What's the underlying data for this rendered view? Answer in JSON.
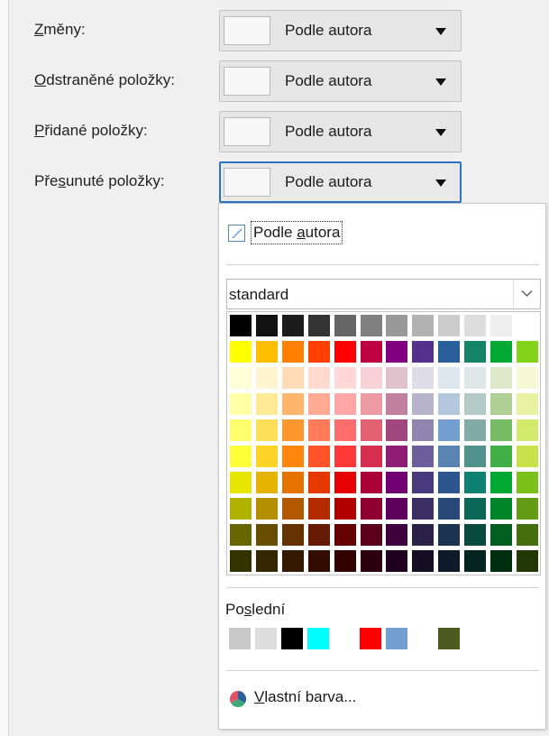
{
  "rows": [
    {
      "label": "Změny",
      "mnemonic_index": 0,
      "value": "Podle autora",
      "focused": false
    },
    {
      "label": "Odstraněné položky",
      "mnemonic_index": 0,
      "value": "Podle autora",
      "focused": false
    },
    {
      "label": "Přidané položky",
      "mnemonic_index": 0,
      "value": "Podle autora",
      "focused": false
    },
    {
      "label": "Přesunuté položky",
      "mnemonic_index": 3,
      "value": "Podle autora",
      "focused": true
    }
  ],
  "label_suffix": ":",
  "popup": {
    "auto_label": "Podle autora",
    "auto_mnemonic_index": 6,
    "palette_value": "standard",
    "palette_grid": [
      [
        "#000000",
        "#111111",
        "#1c1c1c",
        "#333333",
        "#666666",
        "#808080",
        "#999999",
        "#b2b2b2",
        "#cccccc",
        "#dddddd",
        "#eeeeee",
        "#ffffff"
      ],
      [
        "#ffff00",
        "#ffbf00",
        "#ff8000",
        "#ff4000",
        "#ff0000",
        "#bf0041",
        "#800080",
        "#55308d",
        "#2a6099",
        "#158466",
        "#00a933",
        "#81d41a"
      ],
      [
        "#ffffd7",
        "#fff5ce",
        "#ffdbb6",
        "#ffd8ce",
        "#ffd7d7",
        "#f7d1d5",
        "#e0c2cd",
        "#dedce6",
        "#dee6ef",
        "#dee7e5",
        "#dde8cb",
        "#f6f9d4"
      ],
      [
        "#ffffa6",
        "#ffe994",
        "#ffb66c",
        "#ffaa95",
        "#ffa6a6",
        "#ec9ba4",
        "#bf819e",
        "#b7b3ca",
        "#b4c7dc",
        "#b3cac7",
        "#afd095",
        "#e8f2a1"
      ],
      [
        "#ffff6d",
        "#ffde59",
        "#ff972f",
        "#ff7b59",
        "#ff6d6d",
        "#e16173",
        "#a1467e",
        "#8e86ae",
        "#729fcf",
        "#81aca6",
        "#77bc65",
        "#d4ea6b"
      ],
      [
        "#ffff38",
        "#ffd428",
        "#ff860d",
        "#ff5429",
        "#ff3838",
        "#d62e4e",
        "#8d1d75",
        "#6b5e9b",
        "#5983b0",
        "#50938a",
        "#3faf46",
        "#c9e14b"
      ],
      [
        "#e6e600",
        "#e6b400",
        "#e67300",
        "#e63900",
        "#e60000",
        "#ac0039",
        "#730073",
        "#483a7c",
        "#2d5590",
        "#0e8270",
        "#00a834",
        "#7cc11a"
      ],
      [
        "#b2b200",
        "#b28e00",
        "#b25900",
        "#b22c00",
        "#b20000",
        "#8e0030",
        "#5c005c",
        "#3b2f64",
        "#284977",
        "#0c6858",
        "#00852a",
        "#629c14"
      ],
      [
        "#666600",
        "#664d00",
        "#663300",
        "#661a00",
        "#660000",
        "#5a001d",
        "#3d003d",
        "#2a2147",
        "#1c344f",
        "#084a3e",
        "#005e1e",
        "#46700e"
      ],
      [
        "#333300",
        "#332600",
        "#331a00",
        "#330d00",
        "#330000",
        "#2d000f",
        "#1f001f",
        "#150e22",
        "#0e1a28",
        "#04251f",
        "#002f0f",
        "#233807"
      ]
    ],
    "recent_label": "Poslední",
    "recent_mnemonic_index": 2,
    "recent_colors": [
      "#c8c8c8",
      "#dcdcdc",
      "#000000",
      "#00ffff",
      "#ffffff",
      "#ff0000",
      "#729fcf",
      "#ffffff",
      "#4d5b20"
    ],
    "custom_label": "Vlastní barva...",
    "custom_mnemonic_index": 0,
    "custom_icon": "color-wheel-icon"
  }
}
